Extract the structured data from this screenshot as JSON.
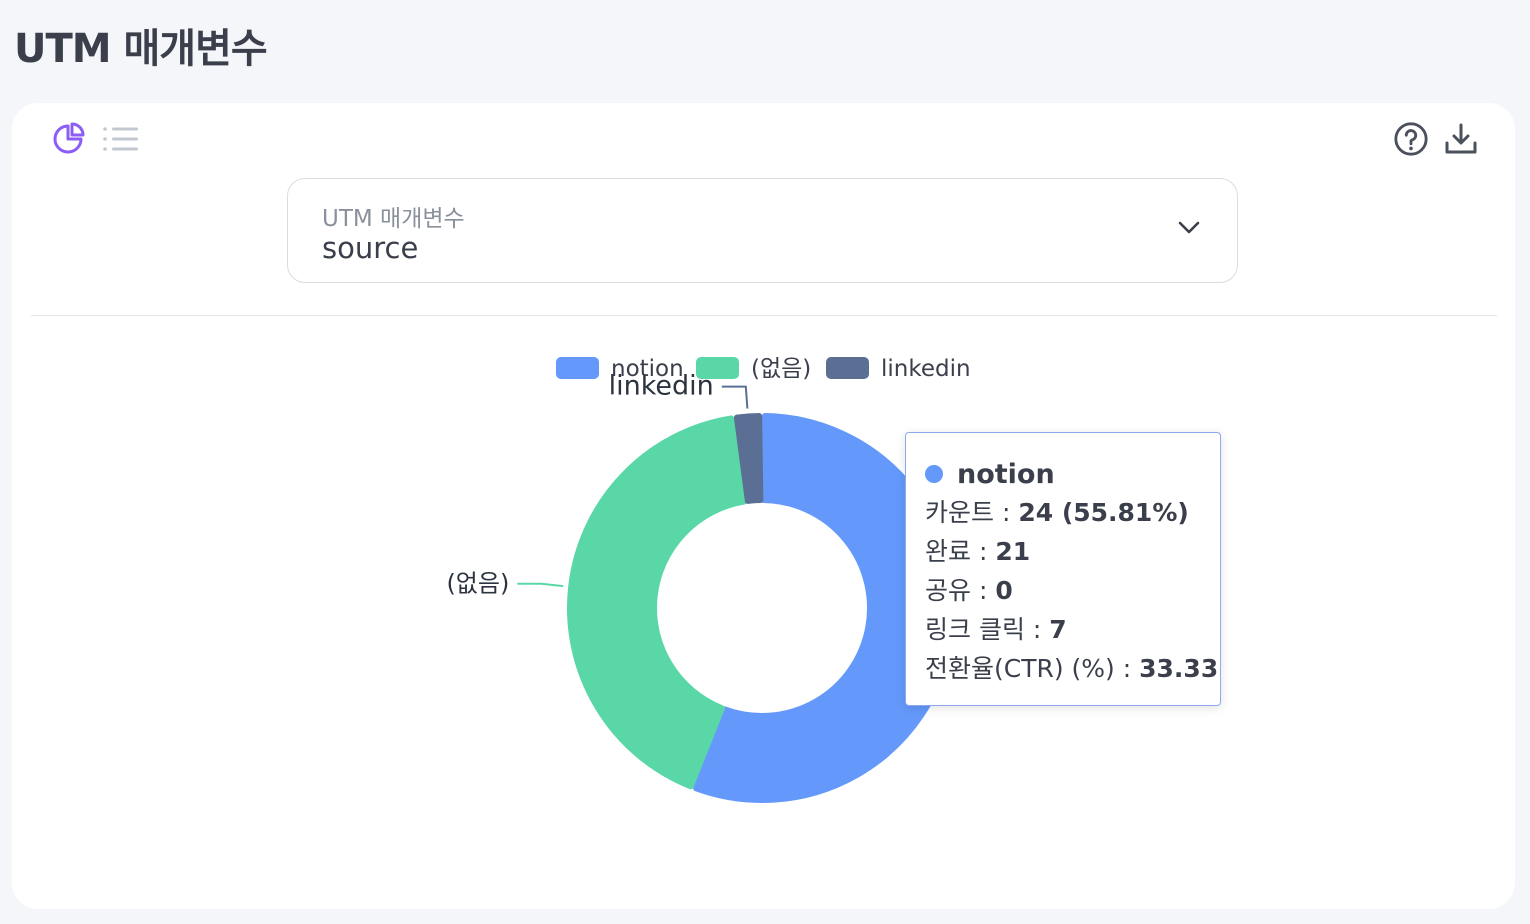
{
  "page": {
    "title": "UTM 매개변수"
  },
  "toolbar": {
    "pie_view_icon": "pie-chart-icon",
    "list_view_icon": "list-icon",
    "help_icon": "help-circle-icon",
    "download_icon": "download-icon"
  },
  "select": {
    "label": "UTM 매개변수",
    "value": "source"
  },
  "colors": {
    "accent": "#8b5cf6",
    "notion": "#6499fb",
    "none": "#5ad7a6",
    "linkedin": "#5b6f95"
  },
  "chart_data": {
    "type": "pie",
    "variant": "donut",
    "legend_position": "top",
    "slices": [
      {
        "label": "notion",
        "value": 24,
        "color": "#6499fb"
      },
      {
        "label": "(없음)",
        "value": 18,
        "color": "#5ad7a6"
      },
      {
        "label": "linkedin",
        "value": 1,
        "color": "#5b6f95"
      }
    ],
    "legend": [
      "notion",
      "(없음)",
      "linkedin"
    ],
    "outside_labels": [
      "linkedin",
      "(없음)"
    ]
  },
  "tooltip": {
    "series": "notion",
    "rows": [
      {
        "key": "카운트 : ",
        "value": "24 (55.81%)"
      },
      {
        "key": "완료 : ",
        "value": "21"
      },
      {
        "key": "공유 : ",
        "value": "0"
      },
      {
        "key": "링크 클릭 : ",
        "value": "7"
      },
      {
        "key": "전환율(CTR) (%) : ",
        "value": "33.33"
      }
    ]
  }
}
